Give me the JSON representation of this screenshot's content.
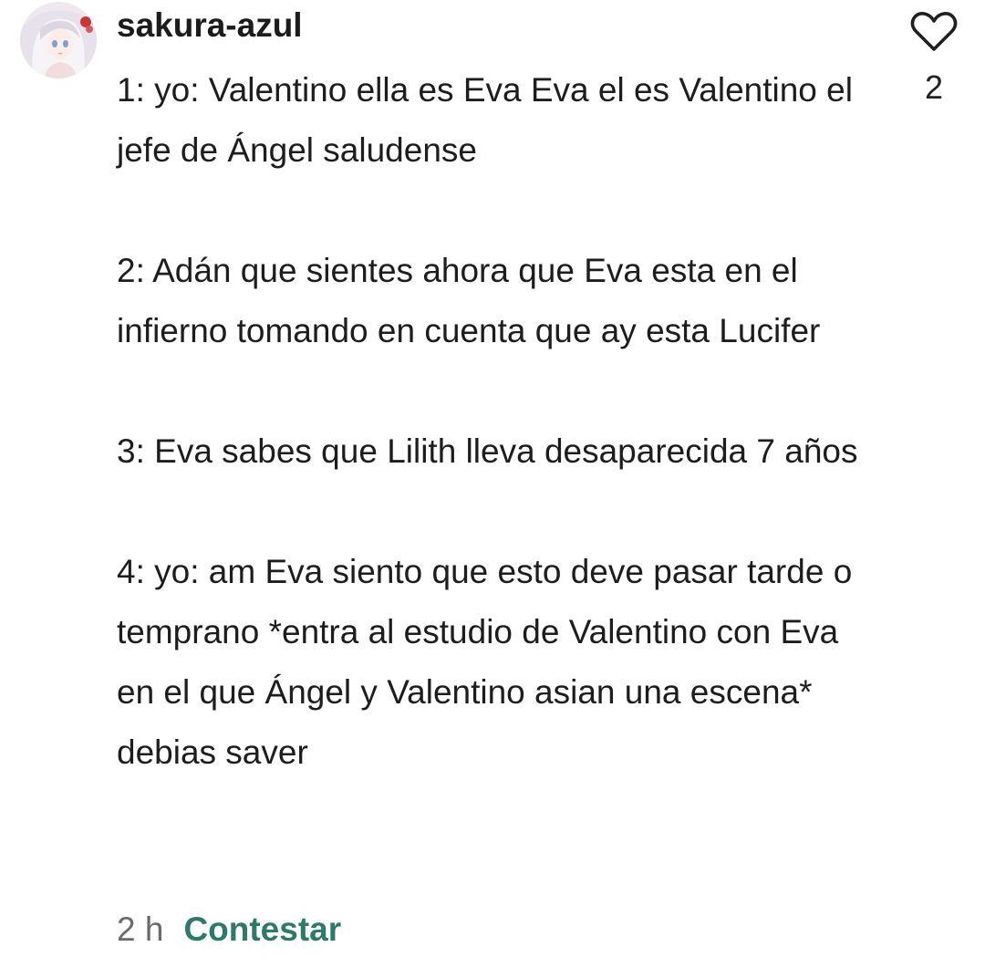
{
  "comment": {
    "username": "sakura-azul",
    "like_count": "2",
    "icons": {
      "like": "heart-icon",
      "avatar": "anime-avatar"
    },
    "paragraphs": [
      "1: yo: Valentino ella es Eva Eva el es Valentino el jefe de Ángel saludense",
      "2: Adán que sientes ahora que Eva esta en el infierno tomando en cuenta que ay esta Lucifer",
      "3: Eva sabes que Lilith lleva desaparecida 7 años",
      "4: yo: am Eva siento que esto deve pasar tarde o temprano *entra al estudio de Valentino con Eva en el que Ángel y Valentino asian una escena* debias saver"
    ],
    "time": "2 h",
    "reply_label": "Contestar"
  },
  "colors": {
    "reply": "#2d7a6a",
    "time": "#6b6b6b",
    "text": "#1d1d1d"
  }
}
